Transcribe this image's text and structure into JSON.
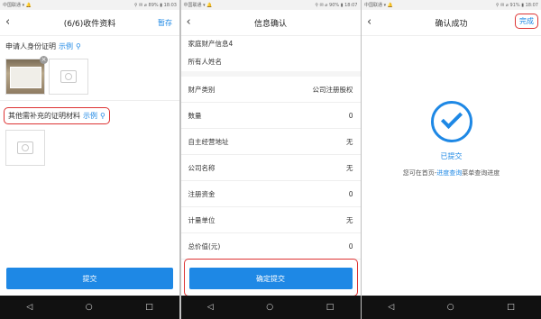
{
  "status": {
    "left": "中国联通 ▾ 🔔",
    "right_1": "⚲ ✉ ⌀ 89% ▮ 18:03",
    "right_2": "⚲ ✉ ⌀ 90% ▮ 18:07",
    "right_3": "⚲ ✉ ⌀ 91% ▮ 18:07"
  },
  "screen1": {
    "title": "(6/6)收件资料",
    "save_label": "暂存",
    "section1_label": "申请人身份证明",
    "section1_link": "示例",
    "section2_label": "其他需补充的证明材料",
    "section2_link": "示例",
    "submit_label": "提交"
  },
  "screen2": {
    "title": "信息确认",
    "header1": "家庭财产信息4",
    "header2": "所有人姓名",
    "rows": [
      {
        "label": "财产类别",
        "value": "公司注册股权"
      },
      {
        "label": "数量",
        "value": "0"
      },
      {
        "label": "自主经营地址",
        "value": "无"
      },
      {
        "label": "公司名称",
        "value": "无"
      },
      {
        "label": "注册资金",
        "value": "0"
      },
      {
        "label": "计量单位",
        "value": "无"
      },
      {
        "label": "总价值(元)",
        "value": "0"
      }
    ],
    "confirm_label": "确定提交"
  },
  "screen3": {
    "title": "确认成功",
    "done_label": "完成",
    "submitted_label": "已提交",
    "info_prefix": "您可在首页-",
    "info_link": "进度查询",
    "info_suffix": "菜单查询进度"
  },
  "nav": {
    "back": "◁",
    "home": "○",
    "recent": "□"
  },
  "colors": {
    "accent": "#1e88e5",
    "highlight": "#d33333"
  }
}
